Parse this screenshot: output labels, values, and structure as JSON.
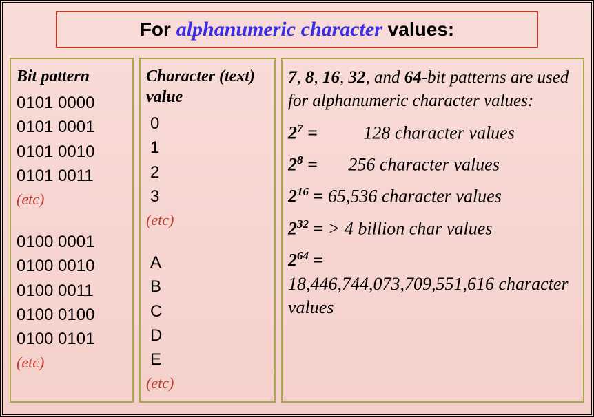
{
  "title": {
    "prefix": "For ",
    "emphasis": "alphanumeric character",
    "suffix": " values:"
  },
  "columns": {
    "bit": {
      "header": "Bit pattern",
      "group1": [
        "0101 0000",
        "0101 0001",
        "0101 0010",
        "0101 0011"
      ],
      "etc1": "(etc)",
      "group2": [
        "0100 0001",
        "0100 0010",
        "0100 0011",
        "0100 0100",
        "0100 0101"
      ],
      "etc2": "(etc)"
    },
    "char": {
      "header": "Character (text) value",
      "group1": [
        "0",
        "1",
        "2",
        "3"
      ],
      "etc1": "(etc)",
      "group2": [
        "A",
        "B",
        "C",
        "D",
        "E"
      ],
      "etc2": "(etc)"
    }
  },
  "info": {
    "intro_bits": [
      "7",
      "8",
      "16",
      "32",
      "64"
    ],
    "intro_text_mid": "-bit patterns are used for alphanumeric character values:",
    "and": "and",
    "equations": [
      {
        "exp": "7",
        "val": "128 character values",
        "gap": "val-gap1"
      },
      {
        "exp": "8",
        "val": "256 character values",
        "gap": "val-gap2"
      },
      {
        "exp": "16",
        "val": "65,536  character values",
        "gap": ""
      },
      {
        "exp": "32",
        "val": "> 4 billion char values",
        "gap": ""
      },
      {
        "exp": "64",
        "val": "18,446,744,073,709,551,616 character values",
        "gap": "",
        "break": true
      }
    ]
  }
}
